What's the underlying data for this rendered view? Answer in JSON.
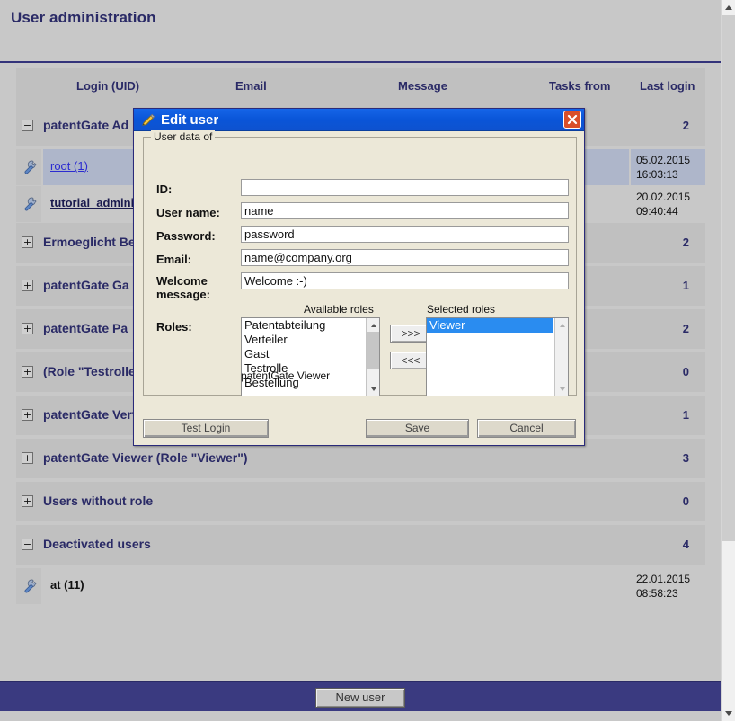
{
  "page": {
    "title": "User administration",
    "new_user_button": "New user"
  },
  "table": {
    "columns": [
      "Login (UID)",
      "Email",
      "Message",
      "Tasks from",
      "Last login"
    ],
    "groups": [
      {
        "toggle": "minus",
        "name": "patentGate Administrator (Role \"Administrator\")",
        "short_name": "patentGate Ad",
        "count": "2",
        "users": [
          {
            "login": "root (1)",
            "email": "",
            "message": "",
            "last_login": "05.02.2015 16:03:13",
            "selected": true,
            "link_style": "blue"
          },
          {
            "login": "tutorial_admini.",
            "email": "",
            "message": "",
            "last_login": "20.02.2015 09:40:44",
            "selected": false,
            "link_style": "dark"
          }
        ]
      },
      {
        "toggle": "plus",
        "name": "Ermoeglicht Be",
        "count": "2",
        "users": []
      },
      {
        "toggle": "plus",
        "name": "patentGate Ga",
        "count": "1",
        "users": []
      },
      {
        "toggle": "plus",
        "name": "patentGate Pa",
        "count": "2",
        "users": []
      },
      {
        "toggle": "plus",
        "name": "(Role \"Testrolle",
        "count": "0",
        "users": []
      },
      {
        "toggle": "plus",
        "name": "patentGate Verteiler (Role \"Verteiler\")",
        "count": "1",
        "users": []
      },
      {
        "toggle": "plus",
        "name": "patentGate Viewer (Role \"Viewer\")",
        "count": "3",
        "users": []
      },
      {
        "toggle": "plus",
        "name": "Users without role",
        "count": "0",
        "users": []
      },
      {
        "toggle": "minus",
        "name": "Deactivated users",
        "count": "4",
        "users": [
          {
            "login": "at (11)",
            "email": "",
            "message": "",
            "last_login": "22.01.2015 08:58:23",
            "selected": false,
            "link_style": "plain"
          }
        ]
      }
    ]
  },
  "dialog": {
    "title": "Edit user",
    "title_icon": "pencil-icon",
    "close_icon": "close-icon",
    "groupbox_legend": "User data of",
    "fields": {
      "id_label": "ID:",
      "id_value": "",
      "username_label": "User name:",
      "username_value": "name",
      "password_label": "Password:",
      "password_value": "password",
      "email_label": "Email:",
      "email_value": "name@company.org",
      "welcome_label": "Welcome message:",
      "welcome_value": "Welcome :-)",
      "roles_label": "Roles:"
    },
    "roles": {
      "available_caption": "Available roles",
      "selected_caption": "Selected roles",
      "available": [
        "Patentabteilung",
        "Verteiler",
        "Gast",
        "Testrolle",
        "Bestellung"
      ],
      "selected": [
        "Viewer"
      ],
      "add_button": ">>>",
      "remove_button": "<<<",
      "hint": "patentGate Viewer"
    },
    "buttons": {
      "test_login": "Test Login",
      "save": "Save",
      "cancel": "Cancel"
    }
  },
  "colors": {
    "accent": "#2a2a66",
    "titlebar": "#0e52cf",
    "bottombar": "#3a3a80",
    "selection": "#2a8cf0",
    "close": "#d94f2a"
  }
}
